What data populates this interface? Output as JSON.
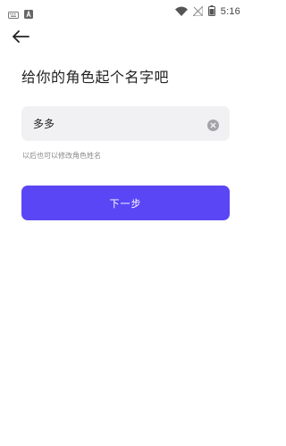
{
  "status_bar": {
    "time": "5:16",
    "icons": [
      "keyboard-icon",
      "notification-a-icon",
      "wifi-icon",
      "no-signal-icon",
      "battery-icon"
    ]
  },
  "nav": {
    "back_icon": "arrow-left-icon"
  },
  "page": {
    "title": "给你的角色起个名字吧"
  },
  "name_input": {
    "value": "多多",
    "clear_icon": "clear-circle-icon"
  },
  "hint": "以后也可以修改角色姓名",
  "next_button": {
    "label": "下一步"
  },
  "colors": {
    "accent": "#5b46f5",
    "input_bg": "#f1f1f3",
    "hint_text": "#888888"
  }
}
